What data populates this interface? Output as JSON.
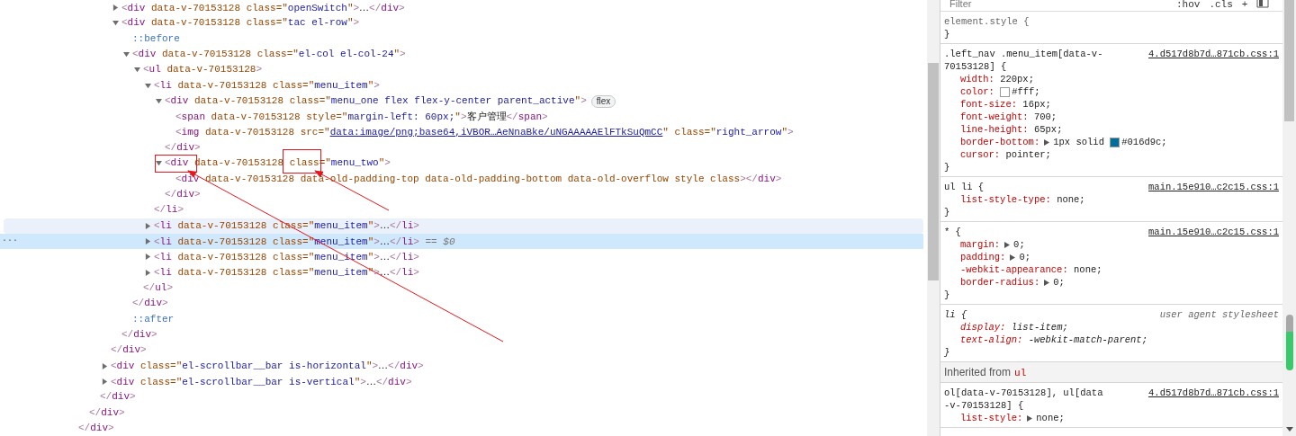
{
  "dom": [
    {
      "close": [
        {
          "kind": "bracket",
          "text": "</"
        },
        {
          "kind": "tag",
          "text": "div"
        },
        {
          "kind": "bracket",
          "text": ">"
        }
      ],
      "children": [
        {
          "close": [
            {
              "kind": "bracket",
              "text": "</"
            },
            {
              "kind": "tag",
              "text": "div"
            },
            {
              "kind": "bracket",
              "text": ">"
            }
          ],
          "children": [
            {
              "close": [
                {
                  "kind": "bracket",
                  "text": "</"
                },
                {
                  "kind": "tag",
                  "text": "div"
                },
                {
                  "kind": "bracket",
                  "text": ">"
                }
              ],
              "children": [
                {
                  "close": [
                    {
                      "kind": "bracket",
                      "text": "</"
                    },
                    {
                      "kind": "tag",
                      "text": "div"
                    },
                    {
                      "kind": "bracket",
                      "text": ">"
                    }
                  ],
                  "children": [
                    {
                      "expanded": false,
                      "open": [
                        {
                          "kind": "bracket",
                          "text": "<"
                        },
                        {
                          "kind": "tag",
                          "text": "div"
                        },
                        {
                          "kind": "attr",
                          "text": " data-v-70153128 class=\""
                        },
                        {
                          "kind": "value",
                          "text": "openSwitch"
                        },
                        {
                          "kind": "attr",
                          "text": "\""
                        },
                        {
                          "kind": "bracket",
                          "text": ">"
                        },
                        {
                          "kind": "text",
                          "text": "…"
                        },
                        {
                          "kind": "bracket",
                          "text": "</"
                        },
                        {
                          "kind": "tag",
                          "text": "div"
                        },
                        {
                          "kind": "bracket",
                          "text": ">"
                        }
                      ]
                    },
                    {
                      "expanded": true,
                      "open": [
                        {
                          "kind": "bracket",
                          "text": "<"
                        },
                        {
                          "kind": "tag",
                          "text": "div"
                        },
                        {
                          "kind": "attr",
                          "text": " data-v-70153128 class=\""
                        },
                        {
                          "kind": "value",
                          "text": "tac el-row"
                        },
                        {
                          "kind": "attr",
                          "text": "\""
                        },
                        {
                          "kind": "bracket",
                          "text": ">"
                        }
                      ],
                      "close": [
                        {
                          "kind": "bracket",
                          "text": "</"
                        },
                        {
                          "kind": "tag",
                          "text": "div"
                        },
                        {
                          "kind": "bracket",
                          "text": ">"
                        }
                      ],
                      "children": [
                        {
                          "open": [
                            {
                              "kind": "pseudo",
                              "text": "::before"
                            }
                          ]
                        },
                        {
                          "expanded": true,
                          "open": [
                            {
                              "kind": "bracket",
                              "text": "<"
                            },
                            {
                              "kind": "tag",
                              "text": "div"
                            },
                            {
                              "kind": "attr",
                              "text": " data-v-70153128 class=\""
                            },
                            {
                              "kind": "value",
                              "text": "el-col el-col-24"
                            },
                            {
                              "kind": "attr",
                              "text": "\""
                            },
                            {
                              "kind": "bracket",
                              "text": ">"
                            }
                          ],
                          "close": [
                            {
                              "kind": "bracket",
                              "text": "</"
                            },
                            {
                              "kind": "tag",
                              "text": "div"
                            },
                            {
                              "kind": "bracket",
                              "text": ">"
                            }
                          ],
                          "children": [
                            {
                              "expanded": true,
                              "open": [
                                {
                                  "kind": "bracket",
                                  "text": "<"
                                },
                                {
                                  "kind": "tag",
                                  "text": "ul"
                                },
                                {
                                  "kind": "attr",
                                  "text": " data-v-70153128"
                                },
                                {
                                  "kind": "bracket",
                                  "text": ">"
                                }
                              ],
                              "close": [
                                {
                                  "kind": "bracket",
                                  "text": "</"
                                },
                                {
                                  "kind": "tag",
                                  "text": "ul"
                                },
                                {
                                  "kind": "bracket",
                                  "text": ">"
                                }
                              ],
                              "children": [
                                {
                                  "expanded": true,
                                  "selected": false,
                                  "hovered": false,
                                  "open": [
                                    {
                                      "kind": "bracket",
                                      "text": "<"
                                    },
                                    {
                                      "kind": "tag",
                                      "text": "li"
                                    },
                                    {
                                      "kind": "attr",
                                      "text": " data-v-70153128 class=\""
                                    },
                                    {
                                      "kind": "value",
                                      "text": "menu_item"
                                    },
                                    {
                                      "kind": "attr",
                                      "text": "\""
                                    },
                                    {
                                      "kind": "bracket",
                                      "text": ">"
                                    }
                                  ],
                                  "close": [
                                    {
                                      "kind": "bracket",
                                      "text": "</"
                                    },
                                    {
                                      "kind": "tag",
                                      "text": "li"
                                    },
                                    {
                                      "kind": "bracket",
                                      "text": ">"
                                    }
                                  ],
                                  "children": [
                                    {
                                      "expanded": true,
                                      "badge": "flex",
                                      "open": [
                                        {
                                          "kind": "bracket",
                                          "text": "<"
                                        },
                                        {
                                          "kind": "tag",
                                          "text": "div"
                                        },
                                        {
                                          "kind": "attr",
                                          "text": " data-v-70153128 class=\""
                                        },
                                        {
                                          "kind": "value",
                                          "text": "menu_one flex flex-y-center parent_active"
                                        },
                                        {
                                          "kind": "attr",
                                          "text": "\""
                                        },
                                        {
                                          "kind": "bracket",
                                          "text": ">"
                                        }
                                      ],
                                      "close": [
                                        {
                                          "kind": "bracket",
                                          "text": "</"
                                        },
                                        {
                                          "kind": "tag",
                                          "text": "div"
                                        },
                                        {
                                          "kind": "bracket",
                                          "text": ">"
                                        }
                                      ],
                                      "children": [
                                        {
                                          "open": [
                                            {
                                              "kind": "bracket",
                                              "text": "<"
                                            },
                                            {
                                              "kind": "tag",
                                              "text": "span"
                                            },
                                            {
                                              "kind": "attr",
                                              "text": " data-v-70153128 style=\""
                                            },
                                            {
                                              "kind": "value",
                                              "text": "margin-left: 60px;"
                                            },
                                            {
                                              "kind": "attr",
                                              "text": "\""
                                            },
                                            {
                                              "kind": "bracket",
                                              "text": ">"
                                            },
                                            {
                                              "kind": "text",
                                              "text": "客户管理"
                                            },
                                            {
                                              "kind": "bracket",
                                              "text": "</"
                                            },
                                            {
                                              "kind": "tag",
                                              "text": "span"
                                            },
                                            {
                                              "kind": "bracket",
                                              "text": ">"
                                            }
                                          ]
                                        },
                                        {
                                          "open": [
                                            {
                                              "kind": "bracket",
                                              "text": "<"
                                            },
                                            {
                                              "kind": "tag",
                                              "text": "img"
                                            },
                                            {
                                              "kind": "attr",
                                              "text": " data-v-70153128 src=\""
                                            },
                                            {
                                              "kind": "link",
                                              "text": "data:image/png;base64,iVBOR…AeNnaBke/uNGAAAAAElFTkSuQmCC"
                                            },
                                            {
                                              "kind": "attr",
                                              "text": "\" class=\""
                                            },
                                            {
                                              "kind": "value",
                                              "text": "right_arrow"
                                            },
                                            {
                                              "kind": "attr",
                                              "text": "\""
                                            },
                                            {
                                              "kind": "bracket",
                                              "text": ">"
                                            }
                                          ]
                                        }
                                      ]
                                    },
                                    {
                                      "expanded": true,
                                      "open": [
                                        {
                                          "kind": "bracket",
                                          "text": "<"
                                        },
                                        {
                                          "kind": "tag",
                                          "text": "div"
                                        },
                                        {
                                          "kind": "attr",
                                          "text": " data-v-70153128 class=\""
                                        },
                                        {
                                          "kind": "value",
                                          "text": "menu_two"
                                        },
                                        {
                                          "kind": "attr",
                                          "text": "\""
                                        },
                                        {
                                          "kind": "bracket",
                                          "text": ">"
                                        }
                                      ],
                                      "close": [
                                        {
                                          "kind": "bracket",
                                          "text": "</"
                                        },
                                        {
                                          "kind": "tag",
                                          "text": "div"
                                        },
                                        {
                                          "kind": "bracket",
                                          "text": ">"
                                        }
                                      ],
                                      "children": [
                                        {
                                          "open": [
                                            {
                                              "kind": "bracket",
                                              "text": "<"
                                            },
                                            {
                                              "kind": "tag",
                                              "text": "div"
                                            },
                                            {
                                              "kind": "attr",
                                              "text": " data-v-70153128 data-old-padding-top data-old-padding-bottom data-old-overflow style class"
                                            },
                                            {
                                              "kind": "bracket",
                                              "text": ">"
                                            },
                                            {
                                              "kind": "bracket",
                                              "text": "</"
                                            },
                                            {
                                              "kind": "tag",
                                              "text": "div"
                                            },
                                            {
                                              "kind": "bracket",
                                              "text": ">"
                                            }
                                          ]
                                        }
                                      ]
                                    }
                                  ]
                                },
                                {
                                  "expanded": false,
                                  "selected": false,
                                  "hovered": true,
                                  "open": [
                                    {
                                      "kind": "bracket",
                                      "text": "<"
                                    },
                                    {
                                      "kind": "tag",
                                      "text": "li"
                                    },
                                    {
                                      "kind": "attr",
                                      "text": " data-v-70153128 class=\""
                                    },
                                    {
                                      "kind": "value",
                                      "text": "menu_item"
                                    },
                                    {
                                      "kind": "attr",
                                      "text": "\""
                                    },
                                    {
                                      "kind": "bracket",
                                      "text": ">"
                                    },
                                    {
                                      "kind": "text",
                                      "text": "…"
                                    },
                                    {
                                      "kind": "bracket",
                                      "text": "</"
                                    },
                                    {
                                      "kind": "tag",
                                      "text": "li"
                                    },
                                    {
                                      "kind": "bracket",
                                      "text": ">"
                                    }
                                  ]
                                },
                                {
                                  "expanded": false,
                                  "selected": true,
                                  "hovered": false,
                                  "gutter": "···",
                                  "open": [
                                    {
                                      "kind": "bracket",
                                      "text": "<"
                                    },
                                    {
                                      "kind": "tag",
                                      "text": "li"
                                    },
                                    {
                                      "kind": "attr",
                                      "text": " data-v-70153128 class=\""
                                    },
                                    {
                                      "kind": "value",
                                      "text": "menu_item"
                                    },
                                    {
                                      "kind": "attr",
                                      "text": "\""
                                    },
                                    {
                                      "kind": "bracket",
                                      "text": ">"
                                    },
                                    {
                                      "kind": "text",
                                      "text": "…"
                                    },
                                    {
                                      "kind": "bracket",
                                      "text": "</"
                                    },
                                    {
                                      "kind": "tag",
                                      "text": "li"
                                    },
                                    {
                                      "kind": "bracket",
                                      "text": ">"
                                    },
                                    {
                                      "kind": "ref",
                                      "text": " == $0"
                                    }
                                  ]
                                },
                                {
                                  "expanded": false,
                                  "selected": false,
                                  "hovered": false,
                                  "open": [
                                    {
                                      "kind": "bracket",
                                      "text": "<"
                                    },
                                    {
                                      "kind": "tag",
                                      "text": "li"
                                    },
                                    {
                                      "kind": "attr",
                                      "text": " data-v-70153128 class=\""
                                    },
                                    {
                                      "kind": "value",
                                      "text": "menu_item"
                                    },
                                    {
                                      "kind": "attr",
                                      "text": "\""
                                    },
                                    {
                                      "kind": "bracket",
                                      "text": ">"
                                    },
                                    {
                                      "kind": "text",
                                      "text": "…"
                                    },
                                    {
                                      "kind": "bracket",
                                      "text": "</"
                                    },
                                    {
                                      "kind": "tag",
                                      "text": "li"
                                    },
                                    {
                                      "kind": "bracket",
                                      "text": ">"
                                    }
                                  ]
                                },
                                {
                                  "expanded": false,
                                  "selected": false,
                                  "hovered": false,
                                  "open": [
                                    {
                                      "kind": "bracket",
                                      "text": "<"
                                    },
                                    {
                                      "kind": "tag",
                                      "text": "li"
                                    },
                                    {
                                      "kind": "attr",
                                      "text": " data-v-70153128 class=\""
                                    },
                                    {
                                      "kind": "value",
                                      "text": "menu_item"
                                    },
                                    {
                                      "kind": "attr",
                                      "text": "\""
                                    },
                                    {
                                      "kind": "bracket",
                                      "text": ">"
                                    },
                                    {
                                      "kind": "text",
                                      "text": "…"
                                    },
                                    {
                                      "kind": "bracket",
                                      "text": "</"
                                    },
                                    {
                                      "kind": "tag",
                                      "text": "li"
                                    },
                                    {
                                      "kind": "bracket",
                                      "text": ">"
                                    }
                                  ]
                                }
                              ]
                            }
                          ]
                        },
                        {
                          "open": [
                            {
                              "kind": "pseudo",
                              "text": "::after"
                            }
                          ]
                        }
                      ]
                    }
                  ]
                },
                {
                  "expanded": false,
                  "open": [
                    {
                      "kind": "bracket",
                      "text": "<"
                    },
                    {
                      "kind": "tag",
                      "text": "div"
                    },
                    {
                      "kind": "attr",
                      "text": " class=\""
                    },
                    {
                      "kind": "value",
                      "text": "el-scrollbar__bar is-horizontal"
                    },
                    {
                      "kind": "attr",
                      "text": "\""
                    },
                    {
                      "kind": "bracket",
                      "text": ">"
                    },
                    {
                      "kind": "text",
                      "text": "…"
                    },
                    {
                      "kind": "bracket",
                      "text": "</"
                    },
                    {
                      "kind": "tag",
                      "text": "div"
                    },
                    {
                      "kind": "bracket",
                      "text": ">"
                    }
                  ]
                },
                {
                  "expanded": false,
                  "open": [
                    {
                      "kind": "bracket",
                      "text": "<"
                    },
                    {
                      "kind": "tag",
                      "text": "div"
                    },
                    {
                      "kind": "attr",
                      "text": " class=\""
                    },
                    {
                      "kind": "value",
                      "text": "el-scrollbar__bar is-vertical"
                    },
                    {
                      "kind": "attr",
                      "text": "\""
                    },
                    {
                      "kind": "bracket",
                      "text": ">"
                    },
                    {
                      "kind": "text",
                      "text": "…"
                    },
                    {
                      "kind": "bracket",
                      "text": "</"
                    },
                    {
                      "kind": "tag",
                      "text": "div"
                    },
                    {
                      "kind": "bracket",
                      "text": ">"
                    }
                  ]
                }
              ]
            }
          ]
        }
      ]
    }
  ],
  "styles": {
    "toolbar": {
      "filter_placeholder": "Filter",
      "hov": ":hov",
      "cls": ".cls",
      "add": "+"
    },
    "rules": [
      {
        "kind": "inline",
        "selector": "element.style {",
        "close": "}"
      },
      {
        "kind": "author",
        "selector": ".left_nav .menu_item[data-v-70153128] {",
        "source": "4.d517d8b7d…871cb.css:1",
        "close": "}",
        "properties": [
          {
            "name": "width:",
            "expandable": false,
            "value": "220px;"
          },
          {
            "name": "color:",
            "expandable": false,
            "swatch": true,
            "value": "#fff;"
          },
          {
            "name": "font-size:",
            "expandable": false,
            "value": "16px;"
          },
          {
            "name": "font-weight:",
            "expandable": false,
            "value": "700;"
          },
          {
            "name": "line-height:",
            "expandable": false,
            "value": "65px;"
          },
          {
            "name": "border-bottom:",
            "expandable": true,
            "prefix": "1px solid",
            "swatch": true,
            "value": "#016d9c;"
          },
          {
            "name": "cursor:",
            "expandable": false,
            "value": "pointer;"
          }
        ]
      },
      {
        "kind": "author",
        "selector": "ul li {",
        "source": "main.15e910…c2c15.css:1",
        "close": "}",
        "properties": [
          {
            "name": "list-style-type:",
            "expandable": false,
            "value": "none;"
          }
        ]
      },
      {
        "kind": "author",
        "selector": "* {",
        "source": "main.15e910…c2c15.css:1",
        "close": "}",
        "properties": [
          {
            "name": "margin:",
            "expandable": true,
            "value": "0;"
          },
          {
            "name": "padding:",
            "expandable": true,
            "value": "0;"
          },
          {
            "name": "-webkit-appearance:",
            "expandable": false,
            "value": "none;"
          },
          {
            "name": "border-radius:",
            "expandable": true,
            "value": "0;"
          }
        ]
      },
      {
        "kind": "user-agent",
        "selector": "li {",
        "source": "user agent stylesheet",
        "close": "}",
        "properties": [
          {
            "name": "display:",
            "expandable": false,
            "value": "list-item;"
          },
          {
            "name": "text-align:",
            "expandable": false,
            "value": "-webkit-match-parent;"
          }
        ]
      },
      {
        "kind": "inherited",
        "label": "Inherited from",
        "tag": "ul"
      },
      {
        "kind": "author",
        "selector": "ol[data-v-70153128], ul[data-v-70153128] {",
        "source": "4.d517d8b7d…871cb.css:1",
        "properties": [
          {
            "name": "list-style:",
            "expandable": true,
            "value": "none;"
          }
        ]
      }
    ]
  }
}
